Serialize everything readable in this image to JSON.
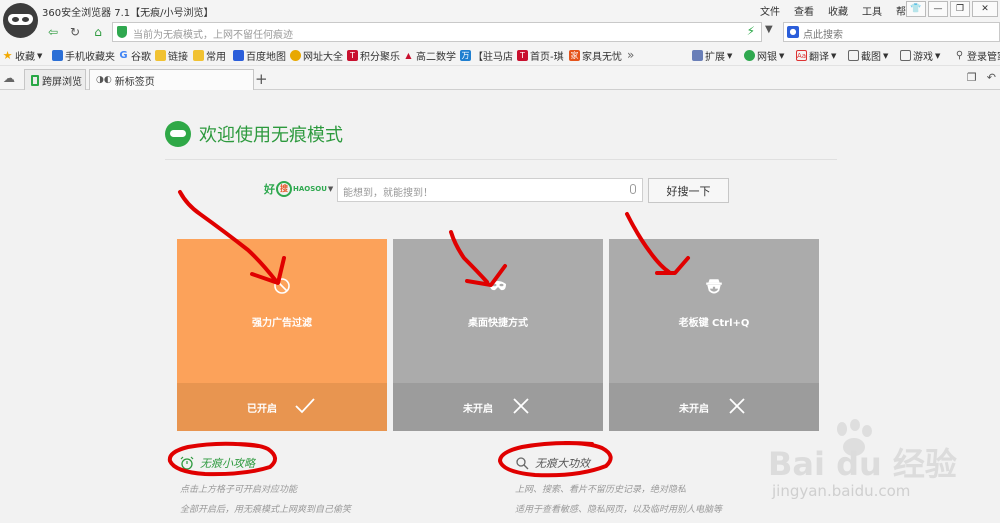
{
  "title_bar": {
    "app_title": "360安全浏览器 7.1【无痕/小号浏览】",
    "menu": [
      "文件",
      "查看",
      "收藏",
      "工具",
      "帮助"
    ]
  },
  "address_bar": {
    "url_placeholder": "当前为无痕模式，上网不留任何痕迹",
    "search_placeholder": "点此搜索"
  },
  "favorites_bar": {
    "items": [
      "收藏",
      "手机收藏夹",
      "谷歌",
      "链接",
      "常用",
      "百度地图",
      "网址大全",
      "积分聚乐",
      "高二数学",
      "【驻马店",
      "首页-琪",
      "家具无忧"
    ],
    "more": "»",
    "right_items": [
      "扩展",
      "网银",
      "翻译",
      "截图",
      "游戏",
      "登录管家"
    ]
  },
  "tabs": [
    {
      "label": "跨屏浏览"
    },
    {
      "label": "新标签页"
    }
  ],
  "content": {
    "welcome": "欢迎使用无痕模式",
    "search": {
      "engine_hao": "好",
      "engine_sou": "搜",
      "engine_en": "HAOSOU",
      "placeholder": "能想到，就能搜到！",
      "button": "好搜一下"
    },
    "cards": [
      {
        "title": "强力广告过滤",
        "status": "已开启",
        "enabled": true
      },
      {
        "title": "桌面快捷方式",
        "status": "未开启",
        "enabled": false
      },
      {
        "title": "老板键 Ctrl+Q",
        "status": "未开启",
        "enabled": false
      }
    ],
    "tips_left": {
      "heading": "无痕小攻略",
      "lines": [
        "点击上方格子可开启对应功能",
        "全部开启后，用无痕模式上网爽到自己偷笑"
      ]
    },
    "tips_right": {
      "heading": "无痕大功效",
      "lines": [
        "上网、搜索、看片不留历史记录，绝对隐私",
        "适用于查看敏感、隐私网页，以及临时用别人电脑等"
      ]
    }
  },
  "watermark": {
    "brand": "Bai du 经验",
    "url": "jingyan.baidu.com"
  },
  "colors": {
    "accent_green": "#2d9a3e",
    "card_on": "#fca25a",
    "card_off": "#ababab",
    "annotation_red": "#e00000"
  }
}
